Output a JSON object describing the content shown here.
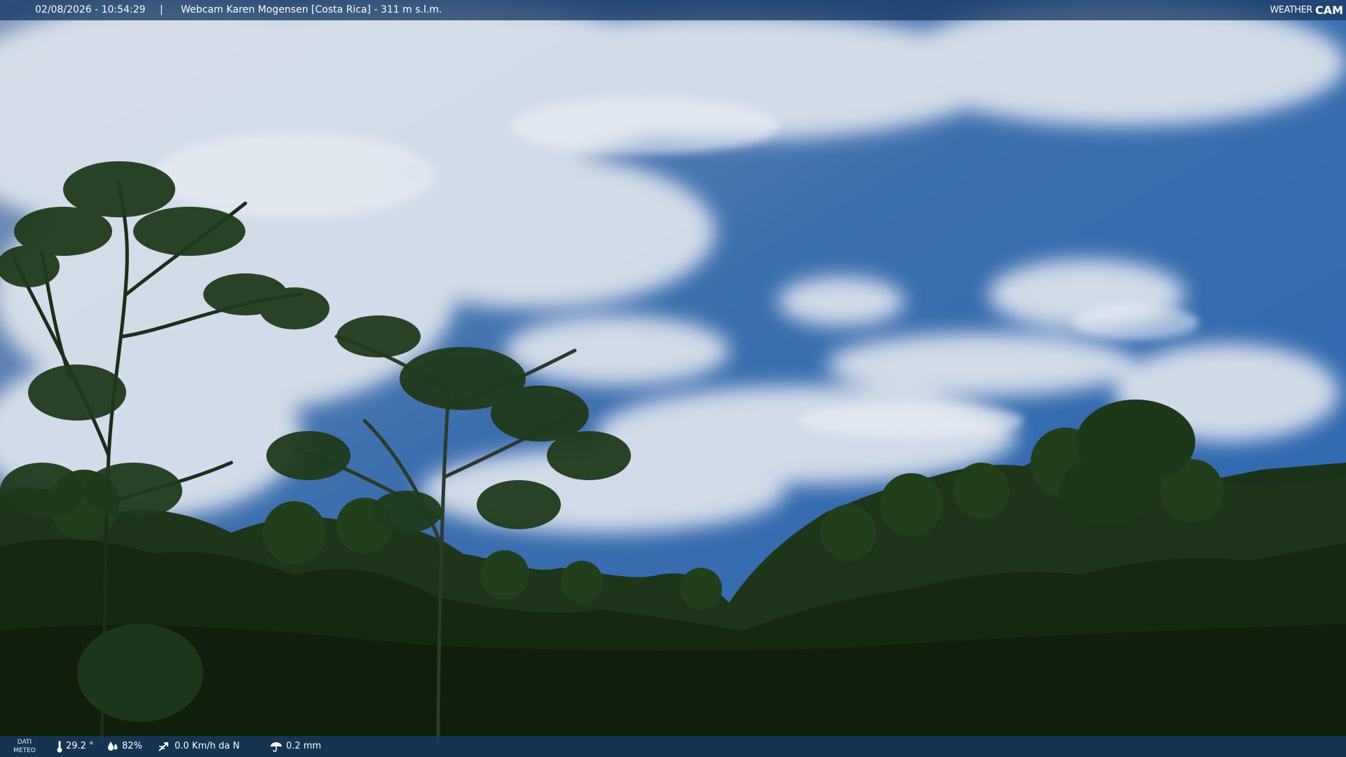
{
  "header": {
    "timestamp": "02/08/2026 - 10:54:29",
    "separator": "|",
    "camera_title": "Webcam Karen Mogensen [Costa Rica]  - 311 m s.l.m.",
    "brand_left": "WEATHER",
    "brand_right": "CAM"
  },
  "weather_bar": {
    "label_line1": "DATI",
    "label_line2": "METEO",
    "temperature": "29.2 °",
    "humidity": "82%",
    "wind": "0.0 Km/h da N",
    "rain": "0.2 mm"
  },
  "colors": {
    "sky_top": "#3a6aa8",
    "sky_blue": "#2f68b4",
    "cloud": "#dfe6ef",
    "forest_dark": "#12240f",
    "forest_mid": "#20391a",
    "overlay_bar": "#163a64"
  },
  "icons": {
    "temperature": "thermometer-icon",
    "humidity": "humidity-drops-icon",
    "wind": "wind-icon",
    "rain": "rain-umbrella-icon"
  }
}
